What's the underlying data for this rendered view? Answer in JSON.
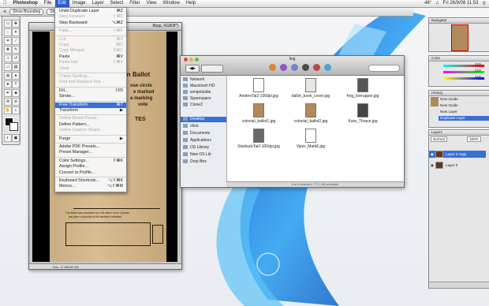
{
  "menubar": {
    "app": "Photoshop",
    "items": [
      "File",
      "Edit",
      "Image",
      "Layer",
      "Select",
      "Filter",
      "View",
      "Window",
      "Help"
    ],
    "selected": "Edit",
    "clock": "Fri 26/9/08 11:53",
    "battery": "48°"
  },
  "optbar": {
    "btn1": "Show Bounding",
    "btn2": "Show"
  },
  "edit_menu": [
    {
      "label": "Undo Duplicate Layer",
      "shortcut": "⌘Z",
      "enabled": true
    },
    {
      "label": "Step Forward",
      "shortcut": "⇧⌘Z",
      "enabled": false
    },
    {
      "label": "Step Backward",
      "shortcut": "⌥⌘Z",
      "enabled": true
    },
    {
      "sep": true
    },
    {
      "label": "Fade...",
      "shortcut": "⇧⌘F",
      "enabled": false
    },
    {
      "sep": true
    },
    {
      "label": "Cut",
      "shortcut": "⌘X",
      "enabled": false
    },
    {
      "label": "Copy",
      "shortcut": "⌘C",
      "enabled": false
    },
    {
      "label": "Copy Merged",
      "shortcut": "⇧⌘C",
      "enabled": false
    },
    {
      "label": "Paste",
      "shortcut": "⌘V",
      "enabled": true
    },
    {
      "label": "Paste Into",
      "shortcut": "⇧⌘V",
      "enabled": false
    },
    {
      "label": "Clear",
      "shortcut": "",
      "enabled": false
    },
    {
      "sep": true
    },
    {
      "label": "Check Spelling...",
      "shortcut": "",
      "enabled": false
    },
    {
      "label": "Find and Replace Text...",
      "shortcut": "",
      "enabled": false
    },
    {
      "sep": true
    },
    {
      "label": "Fill...",
      "shortcut": "⇧F5",
      "enabled": true
    },
    {
      "label": "Stroke...",
      "shortcut": "",
      "enabled": true
    },
    {
      "sep": true
    },
    {
      "label": "Free Transform",
      "shortcut": "⌘T",
      "enabled": true,
      "highlight": true
    },
    {
      "label": "Transform",
      "shortcut": "▶",
      "enabled": true
    },
    {
      "sep": true
    },
    {
      "label": "Define Brush Preset...",
      "shortcut": "",
      "enabled": false
    },
    {
      "label": "Define Pattern...",
      "shortcut": "",
      "enabled": true
    },
    {
      "label": "Define Custom Shape...",
      "shortcut": "",
      "enabled": false
    },
    {
      "sep": true
    },
    {
      "label": "Purge",
      "shortcut": "▶",
      "enabled": true
    },
    {
      "sep": true
    },
    {
      "label": "Adobe PDF Presets...",
      "shortcut": "",
      "enabled": true
    },
    {
      "label": "Preset Manager...",
      "shortcut": "",
      "enabled": true
    },
    {
      "sep": true
    },
    {
      "label": "Color Settings...",
      "shortcut": "⇧⌘K",
      "enabled": true
    },
    {
      "label": "Assign Profile...",
      "shortcut": "",
      "enabled": true
    },
    {
      "label": "Convert to Profile...",
      "shortcut": "",
      "enabled": true
    },
    {
      "sep": true
    },
    {
      "label": "Keyboard Shortcuts...",
      "shortcut": "⌥⇧⌘K",
      "enabled": true
    },
    {
      "label": "Menus...",
      "shortcut": "⌥⇧⌘M",
      "enabled": true
    }
  ],
  "doc": {
    "title": "8bpp, RGB/8*)",
    "status": "Doc: 17.6M/32.0M",
    "ballot": {
      "head": "tion Ballot",
      "l1": "ose circle",
      "l2": "e marked",
      "l3": "a marking",
      "l4": "vote",
      "l5": "TES",
      "foot1": "This Ballot was completed by a full citizen of the Colonies",
      "foot2": "and given voluntarily for the aesthetic indicators"
    }
  },
  "finder": {
    "title": "ling",
    "sidebar": [
      "Network",
      "Macintosh HD",
      "wmipelutdie",
      "Sparespace",
      "Clone2",
      "Desktop",
      "chris",
      "Documents",
      "Applications",
      "OS Library",
      "New OS Lib",
      "Drop Box"
    ],
    "selected_sidebar": "Desktop",
    "files": [
      "AndersTai2-100dpi.jpg",
      "ballot_book_cover.jpg",
      "frog_borrupper.jpg",
      "colonial_ballot1.jpg",
      "colonial_ballot2.jpg",
      "Kara_Thrace.jpg",
      "StarbuckTai2-100dpi.jpg",
      "Viper_Mark6.jpg"
    ],
    "footer": "8 of 8 selected, 77.2 GB available"
  },
  "palettes": {
    "navigator": "Navigator",
    "color_tab": "Color",
    "color_values": [
      "219",
      "219",
      "219"
    ],
    "history_tab": "History",
    "history": [
      "New Guide",
      "New Guide",
      "New Layer",
      "Duplicate Layer"
    ],
    "layers_tab": "Layers",
    "blend": "Normal",
    "opacity": "100%",
    "layers": [
      "Layer 0 copy",
      "Layer 0"
    ],
    "layers_selected": "Layer 0 copy"
  },
  "colors": {
    "accent": "#3a6fd8"
  }
}
